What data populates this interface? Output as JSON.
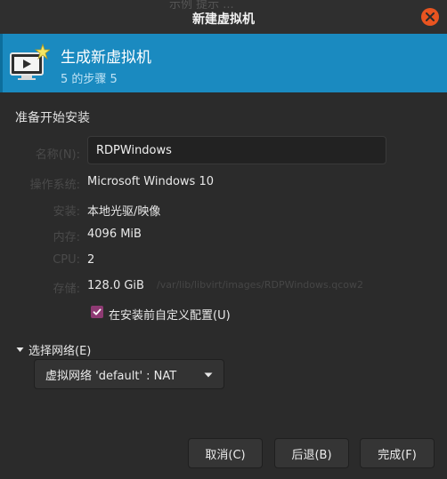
{
  "window": {
    "background_text": "示例 提示 ...",
    "title": "新建虚拟机",
    "close_icon": "close-icon"
  },
  "banner": {
    "icon": "monitor-new-icon",
    "title": "生成新虚拟机",
    "step": "5 的步骤 5",
    "color": "#1a8ac0"
  },
  "summary": {
    "heading": "准备开始安装",
    "name_label": "名称(N):",
    "name_value": "RDPWindows",
    "os_label": "操作系统:",
    "os_value": "Microsoft Windows 10",
    "install_label": "安装:",
    "install_value": "本地光驱/映像",
    "memory_label": "内存:",
    "memory_value": "4096 MiB",
    "cpu_label": "CPU:",
    "cpu_value": "2",
    "storage_label": "存储:",
    "storage_value": "128.0 GiB",
    "storage_path": "/var/lib/libvirt/images/RDPWindows.qcow2"
  },
  "customize": {
    "checked": true,
    "label": "在安装前自定义配置(U)",
    "accent": "#8e3a73"
  },
  "network": {
    "expander_label": "选择网络(E)",
    "selected": "虚拟网络 'default' : NAT"
  },
  "buttons": {
    "cancel": "取消(C)",
    "back": "后退(B)",
    "finish": "完成(F)"
  }
}
